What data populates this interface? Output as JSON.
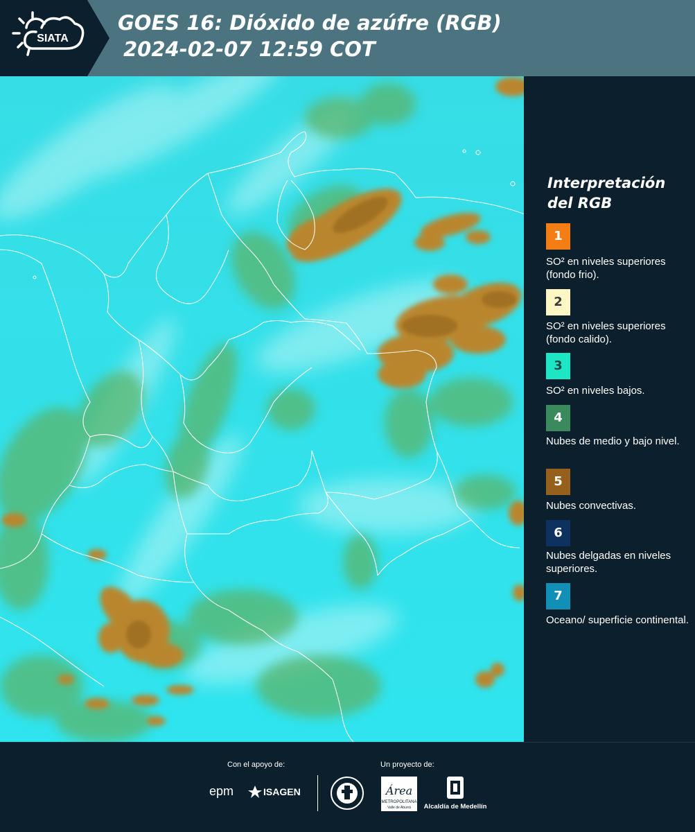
{
  "header": {
    "logo_text": "SIATA",
    "title_line1": "GOES 16: Dióxido de azúfre (RGB)",
    "title_line2": "2024-02-07 12:59 COT"
  },
  "legend": {
    "title": "Interpretación del RGB",
    "items": [
      {
        "number": "1",
        "text": "SO² en niveles superiores (fondo frio).",
        "color": "#f57e14",
        "text_color": "#ffffff"
      },
      {
        "number": "2",
        "text": "SO² en niveles superiores (fondo calido).",
        "color": "#fcf6c4",
        "text_color": "#3a3a3a"
      },
      {
        "number": "3",
        "text": "SO² en niveles bajos.",
        "color": "#1ce6c4",
        "text_color": "#1d4a44"
      },
      {
        "number": "4",
        "text": "Nubes de medio y bajo nivel.",
        "color": "#3b8a5e",
        "text_color": "#ffffff"
      },
      {
        "number": "5",
        "text": "Nubes convectivas.",
        "color": "#95601c",
        "text_color": "#ffffff"
      },
      {
        "number": "6",
        "text": "Nubes delgadas en niveles superiores.",
        "color": "#0e3260",
        "text_color": "#ffffff"
      },
      {
        "number": "7",
        "text": "Oceano/ superficie continental.",
        "color": "#128fb6",
        "text_color": "#ffffff"
      }
    ]
  },
  "footer": {
    "support_label": "Con el apoyo de:",
    "project_label": "Un proyecto de:",
    "logos": {
      "epm": "epm",
      "isagen": "ISAGEN",
      "area_script": "Área",
      "area_line1": "METROPOLITANA",
      "area_line2": "Valle de Aburrá",
      "alcaldia": "Alcaldía de Medellín"
    }
  },
  "colors": {
    "header_bg": "#4b7480",
    "dark_bg": "#0c1f2c",
    "map_base": "#2fe0ea",
    "cloud_orange": "#b8862c",
    "cloud_green": "#58b66c"
  }
}
